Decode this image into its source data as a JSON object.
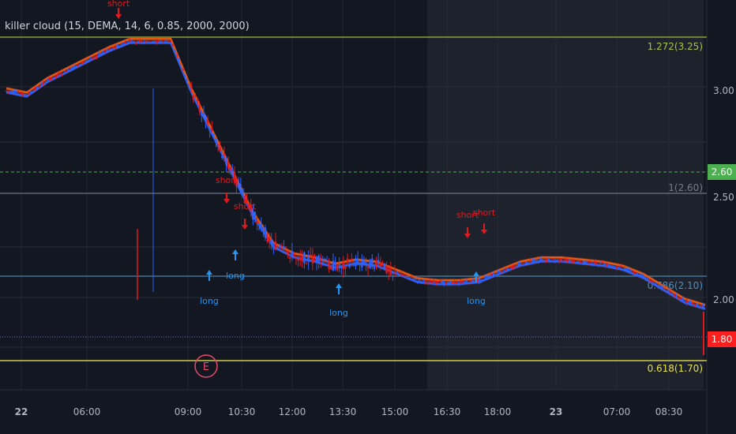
{
  "indicator": {
    "title": "killer cloud (15, DEMA, 14, 6, 0.85, 2000, 2000)"
  },
  "colors": {
    "background": "#131722",
    "session_highlight": "#1e222d",
    "grid": "#2a2e39",
    "up": "#2962ff",
    "down": "#e0191f",
    "signal_short": "#e0191f",
    "signal_long": "#2196f3",
    "fib_1272": "#a8c23a",
    "fib_1": "#787b86",
    "fib_0786": "#4f8fbf",
    "fib_0618": "#e6e04a",
    "alert_line": "#4caf50",
    "earnings": "#e84a6b"
  },
  "chart_data": {
    "type": "candlestick",
    "x_ticks": [
      "22",
      "06:00",
      "09:00",
      "10:30",
      "12:00",
      "13:30",
      "15:00",
      "16:30",
      "18:00",
      "23",
      "07:00",
      "08:30"
    ],
    "y_ticks": [
      "3.00",
      "2.50",
      "2.00"
    ],
    "y_range": [
      1.55,
      3.44
    ],
    "price_labels": [
      {
        "text": "2.60",
        "value": 2.6,
        "color": "#4caf50"
      },
      {
        "text": "1.80",
        "value": 1.8,
        "color": "#ff1f1f"
      }
    ],
    "fib_levels": [
      {
        "label": "1.272(3.25)",
        "value": 3.25,
        "color": "#a8c23a"
      },
      {
        "label": "1(2.60)",
        "value": 2.6,
        "color": "#787b86"
      },
      {
        "label": "0.786(2.10)",
        "value": 2.1,
        "color": "#4f8fbf"
      },
      {
        "label": "0.618(1.70)",
        "value": 1.7,
        "color": "#e6e04a"
      }
    ],
    "horizontal_lines": [
      {
        "value": 2.6,
        "color": "#4caf50",
        "style": "dashed"
      },
      {
        "value": 1.8,
        "color": "#5b7fd6",
        "style": "dotted"
      }
    ],
    "signals": [
      {
        "type": "short",
        "label": "short",
        "x": "06:50",
        "value": 3.3
      },
      {
        "type": "short",
        "label": "short",
        "x": "10:10",
        "value": 2.38
      },
      {
        "type": "short",
        "label": "short",
        "x": "10:45",
        "value": 2.3
      },
      {
        "type": "short",
        "label": "short",
        "x": "17:10",
        "value": 2.25
      },
      {
        "type": "short",
        "label": "short",
        "x": "17:30",
        "value": 2.25
      },
      {
        "type": "long",
        "label": "long",
        "x": "09:45",
        "value": 2.1
      },
      {
        "type": "long",
        "label": "long",
        "x": "10:20",
        "value": 2.18
      },
      {
        "type": "long",
        "label": "long",
        "x": "13:15",
        "value": 2.06
      },
      {
        "type": "long",
        "label": "long",
        "x": "17:20",
        "value": 2.1
      }
    ],
    "earnings_marker": {
      "label": "E",
      "x": "09:15"
    },
    "cloud_path": [
      3.0,
      2.98,
      3.05,
      3.1,
      3.15,
      3.2,
      3.24,
      3.24,
      3.24,
      3.0,
      2.8,
      2.6,
      2.4,
      2.25,
      2.2,
      2.18,
      2.15,
      2.17,
      2.16,
      2.12,
      2.08,
      2.07,
      2.07,
      2.08,
      2.12,
      2.16,
      2.18,
      2.18,
      2.17,
      2.16,
      2.14,
      2.1,
      2.04,
      1.98,
      1.95
    ]
  }
}
